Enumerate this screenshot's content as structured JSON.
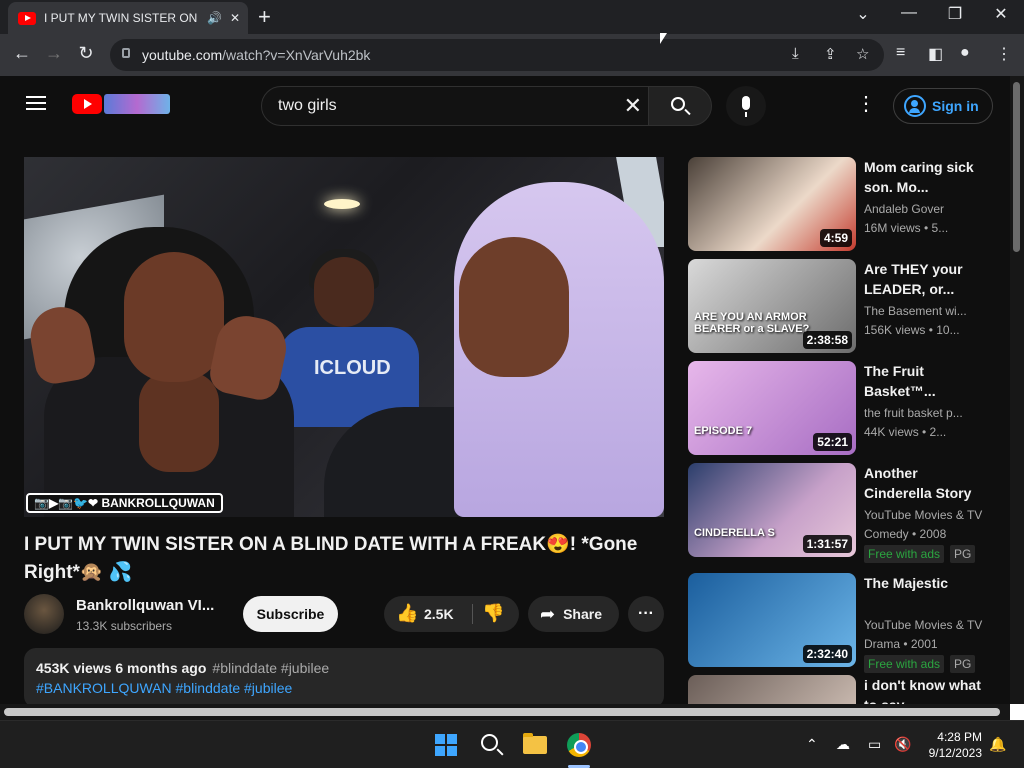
{
  "browser": {
    "tab_title": "I PUT MY TWIN SISTER ON A BLIND DATE WITH A FREAK",
    "tab_audio_icon": "speaker-icon",
    "url_host": "youtube.com",
    "url_path": "/watch?v=XnVarVuh2bk"
  },
  "youtube": {
    "search_query": "two girls",
    "signin_label": "Sign in"
  },
  "video": {
    "title": "I PUT MY TWIN SISTER ON A BLIND DATE WITH A FREAK😍! *Gone Right*🙊 💦",
    "watermark": "📷▶📷🐦❤ BANKROLLQUWAN",
    "overlay_text": "ICLOUD",
    "channel_name": "Bankrollquwan VI...",
    "subscribers": "13.3K subscribers",
    "subscribe_label": "Subscribe",
    "likes": "2.5K",
    "share_label": "Share",
    "views_age": "453K views  6 months ago",
    "meta_tags": "#blinddate #jubilee",
    "desc_tags": "#BANKROLLQUWAN #blinddate #jubilee"
  },
  "recommendations": [
    {
      "title": "Mom caring sick son. Mo...",
      "channel": "Andaleb Gover",
      "views": "16M views • 5...",
      "duration": "4:59",
      "thumb_text": ""
    },
    {
      "title": "Are THEY your LEADER, or...",
      "channel": "The Basement wi...",
      "views": "156K views • 10...",
      "duration": "2:38:58",
      "thumb_text": "ARE YOU AN ARMOR BEARER or a SLAVE?"
    },
    {
      "title": "The Fruit Basket™...",
      "channel": "the fruit basket p...",
      "views": "44K views • 2...",
      "duration": "52:21",
      "thumb_text": "EPISODE 7"
    },
    {
      "title": "Another Cinderella Story",
      "channel": "YouTube Movies & TV",
      "views": "Comedy • 2008",
      "duration": "1:31:57",
      "thumb_text": "CINDERELLA S",
      "badge_free": "Free with ads",
      "badge_rating": "PG"
    },
    {
      "title": "The Majestic",
      "channel": "YouTube Movies & TV",
      "views": "Drama • 2001",
      "duration": "2:32:40",
      "thumb_text": "",
      "badge_free": "Free with ads",
      "badge_rating": "PG"
    },
    {
      "title": "i don't know what to say",
      "channel": "",
      "views": "",
      "duration": "",
      "thumb_text": ""
    }
  ],
  "taskbar": {
    "time": "4:28 PM",
    "date": "9/12/2023"
  }
}
